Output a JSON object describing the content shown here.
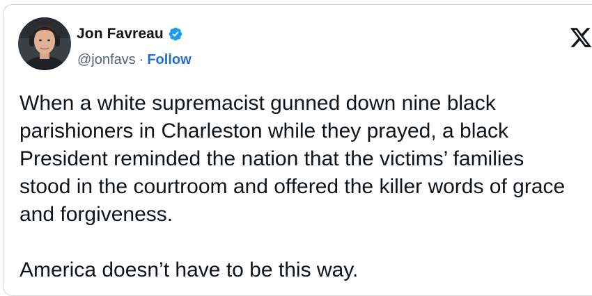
{
  "author": {
    "name": "Jon Favreau",
    "handle": "@jonfavs",
    "separator": "·",
    "follow_label": "Follow",
    "verified_color": "#1d9bf0"
  },
  "tweet": {
    "paragraph_1": "When a white supremacist gunned down nine black parishioners in Charleston while they prayed, a black President reminded the nation that the victims’ families stood in the courtroom and offered the killer words of grace and forgiveness.",
    "paragraph_2": "America doesn’t have to be this way."
  },
  "icons": {
    "platform_logo": "x-logo-icon",
    "verified": "verified-badge-icon"
  },
  "colors": {
    "text": "#0f1419",
    "secondary": "#536471",
    "link": "#1d6fd6",
    "border": "#cfd9de"
  }
}
